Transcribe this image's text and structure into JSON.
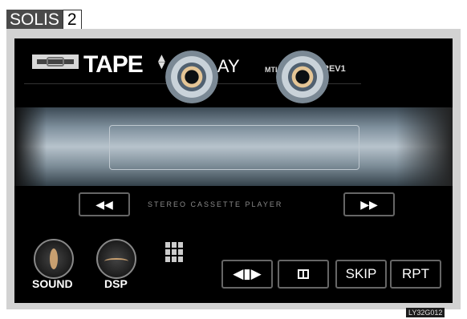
{
  "badge": {
    "title": "SOLIS",
    "number": "2"
  },
  "screen": {
    "mode_title": "TAPE",
    "status": "PLAY",
    "tape_type": "MTL",
    "reverse": "REV1",
    "caption": "STEREO CASSETTE PLAYER",
    "rewind_icon": "rewind-icon",
    "ff_icon": "fast-forward-icon"
  },
  "controls": {
    "sound": "SOUND",
    "dsp": "DSP",
    "skip": "SKIP",
    "rpt": "RPT"
  },
  "ref_code": "LY32G012"
}
